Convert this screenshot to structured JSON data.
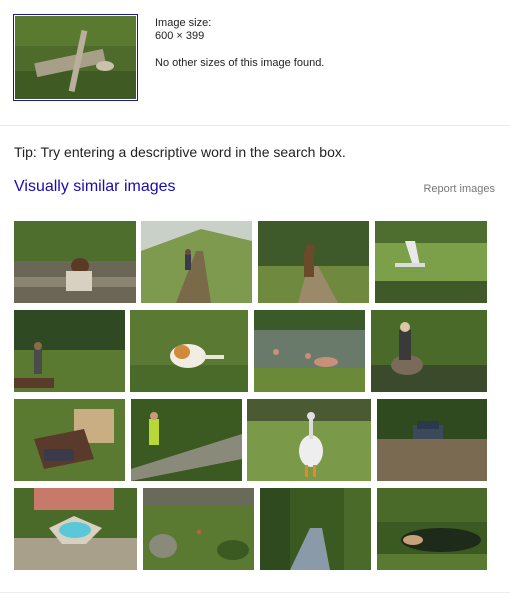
{
  "image_info": {
    "size_label": "Image size:",
    "size_value": "600 × 399",
    "other_sizes": "No other sizes of this image found."
  },
  "tip": "Tip: Try entering a descriptive word in the search box.",
  "similar": {
    "title": "Visually similar images",
    "report_link": "Report images"
  },
  "tile_names": [
    "child-sitting-on-path",
    "hiker-on-grassy-hill",
    "dog-on-dirt-road",
    "white-sculpture-in-field",
    "person-walking-in-field",
    "cat-lying-in-grass",
    "people-bathing-in-pond",
    "person-on-rock-by-stream",
    "person-under-cardboard-box",
    "man-by-stone-wall",
    "goose-standing",
    "car-in-muddy-field",
    "courtyard-fountain",
    "garden-hillside",
    "forest-creek",
    "pond-in-woods"
  ]
}
